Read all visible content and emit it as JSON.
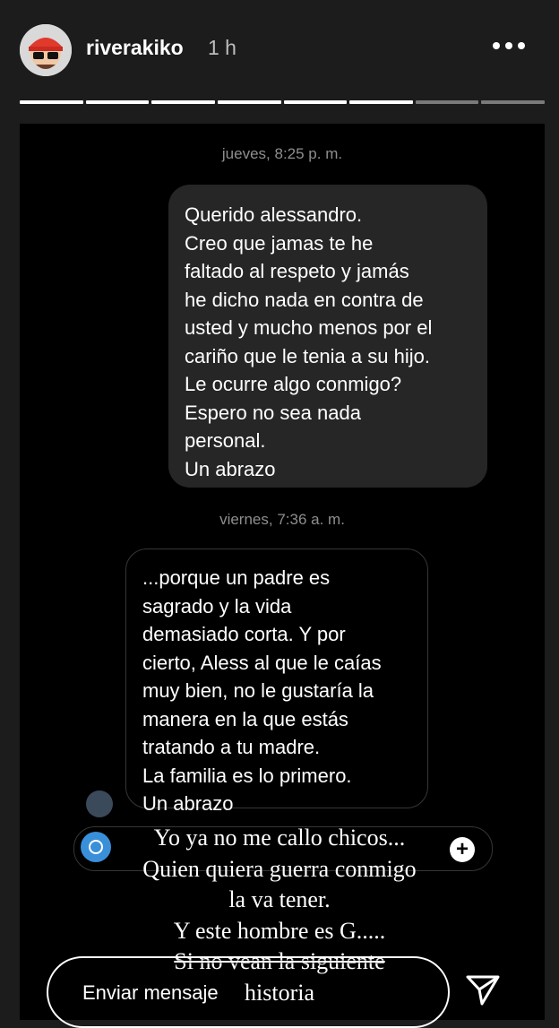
{
  "header": {
    "username": "riverakiko",
    "time_ago": "1 h",
    "progress": {
      "segments": 8,
      "completed": 6
    }
  },
  "dm": {
    "timestamp_1": "jueves, 8:25 p. m.",
    "message_outgoing": [
      "Querido alessandro.",
      "Creo que jamas te he",
      "faltado al respeto y jamás",
      "he dicho nada en contra de",
      "usted y mucho menos por el",
      "cariño que le tenia a su hijo.",
      "Le ocurre algo conmigo?",
      "Espero no sea nada",
      "personal.",
      "Un abrazo"
    ],
    "timestamp_2": "viernes, 7:36 a. m.",
    "message_incoming": [
      "...porque un padre es",
      "sagrado y la vida",
      "demasiado corta. Y por",
      "cierto, Aless al que le caías",
      "muy bien, no le gustaría la",
      "manera en la que estás",
      "tratando a tu madre.",
      "La familia es lo primero.",
      "Un abrazo"
    ],
    "composer_plus": "+"
  },
  "caption": {
    "lines": [
      "Yo ya no me callo chicos...",
      "Quien quiera guerra conmigo",
      "la va tener.",
      "Y este hombre es G.....",
      "Si no vean la siguiente",
      "historia"
    ]
  },
  "footer": {
    "placeholder": "Enviar mensaje",
    "send_icon": "paper-plane-icon"
  }
}
